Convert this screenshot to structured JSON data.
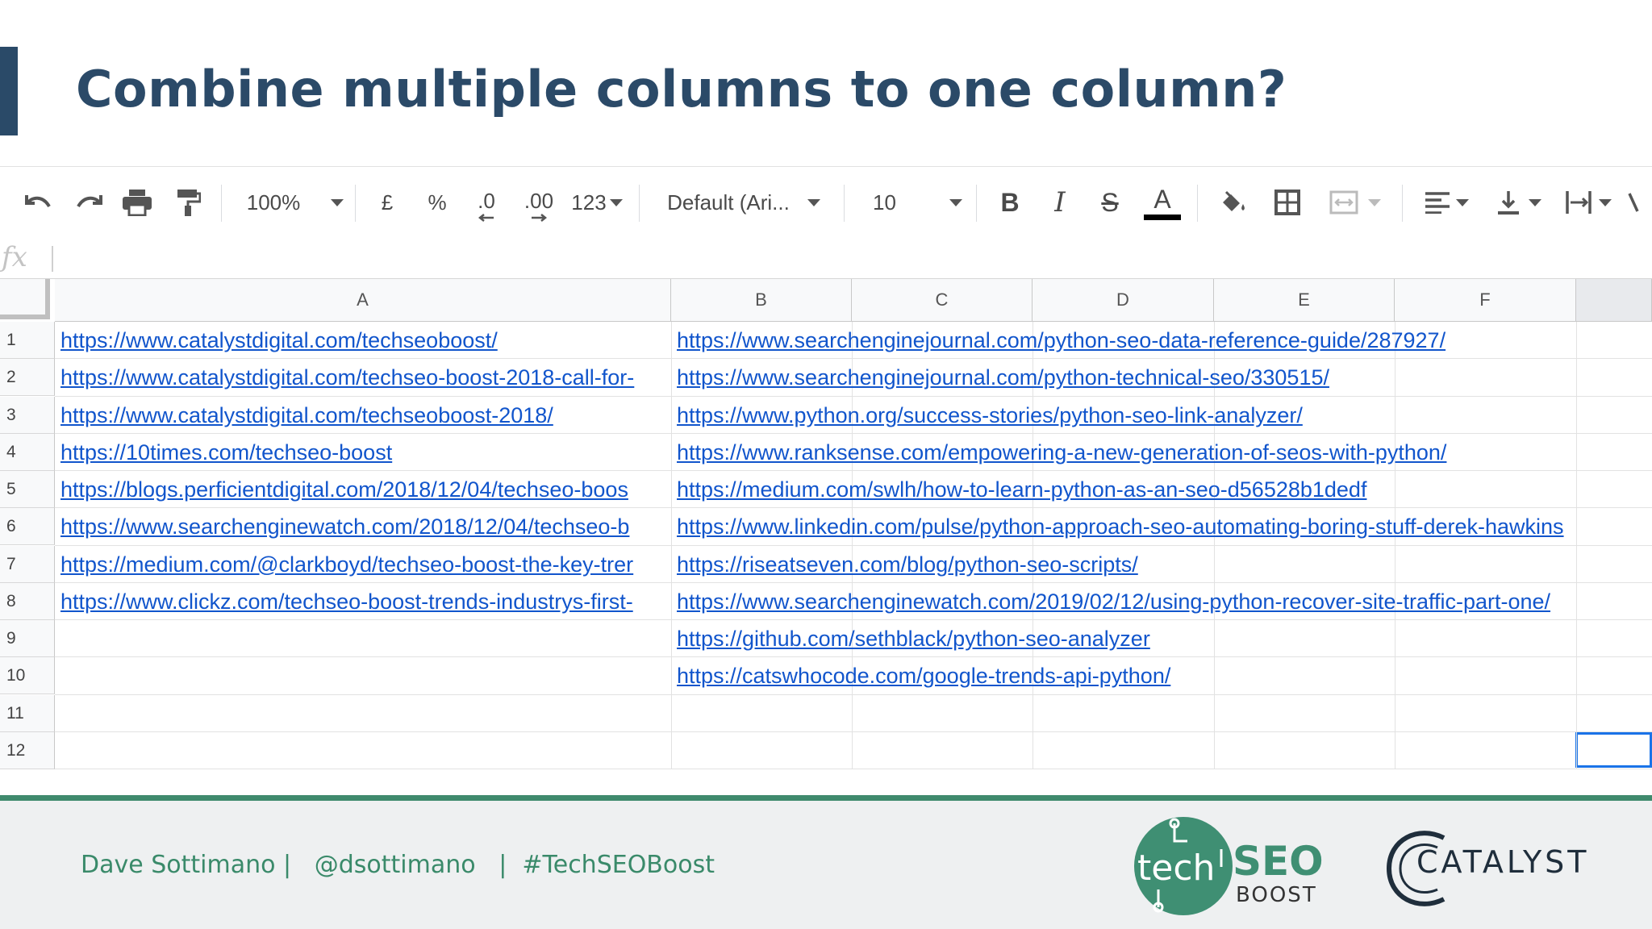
{
  "slide": {
    "title": "Combine multiple columns to one column?"
  },
  "toolbar": {
    "zoom": "100%",
    "currency_symbol": "£",
    "percent_symbol": "%",
    "decrease_decimal": ".0",
    "increase_decimal": ".00",
    "more_formats": "123",
    "font_family": "Default (Ari...",
    "font_size": "10",
    "icons": [
      "undo-icon",
      "redo-icon",
      "print-icon",
      "paint-format-icon",
      "bold-icon",
      "italic-icon",
      "strikethrough-icon",
      "text-color-icon",
      "fill-color-icon",
      "borders-icon",
      "merge-cells-icon",
      "horizontal-align-icon",
      "vertical-align-icon",
      "text-wrap-icon"
    ],
    "text_color_swatch": "#000000"
  },
  "formula_bar": {
    "fx_label": "fx",
    "value": ""
  },
  "sheet": {
    "columns": [
      "A",
      "B",
      "C",
      "D",
      "E",
      "F"
    ],
    "rows": [
      "1",
      "2",
      "3",
      "4",
      "5",
      "6",
      "7",
      "8",
      "9",
      "10",
      "11",
      "12"
    ],
    "column_a": [
      "https://www.catalystdigital.com/techseoboost/",
      "https://www.catalystdigital.com/techseo-boost-2018-call-for-",
      "https://www.catalystdigital.com/techseoboost-2018/",
      "https://10times.com/techseo-boost",
      "https://blogs.perficientdigital.com/2018/12/04/techseo-boos",
      "https://www.searchenginewatch.com/2018/12/04/techseo-b",
      "https://medium.com/@clarkboyd/techseo-boost-the-key-trer",
      "https://www.clickz.com/techseo-boost-trends-industrys-first-",
      "",
      "",
      "",
      ""
    ],
    "column_b": [
      "https://www.searchenginejournal.com/python-seo-data-reference-guide/287927/",
      "https://www.searchenginejournal.com/python-technical-seo/330515/",
      "https://www.python.org/success-stories/python-seo-link-analyzer/",
      "https://www.ranksense.com/empowering-a-new-generation-of-seos-with-python/",
      "https://medium.com/swlh/how-to-learn-python-as-an-seo-d56528b1dedf",
      "https://www.linkedin.com/pulse/python-approach-seo-automating-boring-stuff-derek-hawkins",
      "https://riseatseven.com/blog/python-seo-scripts/",
      "https://www.searchenginewatch.com/2019/02/12/using-python-recover-site-traffic-part-one/",
      "https://github.com/sethblack/python-seo-analyzer",
      "https://catswhocode.com/google-trends-api-python/",
      "",
      ""
    ],
    "link_color": "#1155cc",
    "selection_color": "#1a73e8"
  },
  "footer": {
    "credits": "Dave Sottimano |   @dsottimano   |  #TechSEOBoost",
    "logo_tech": "tech",
    "logo_seo": "SEO",
    "logo_boost": "BOOST",
    "logo_catalyst": "CATALYST",
    "accent_color": "#3f8a6d"
  }
}
